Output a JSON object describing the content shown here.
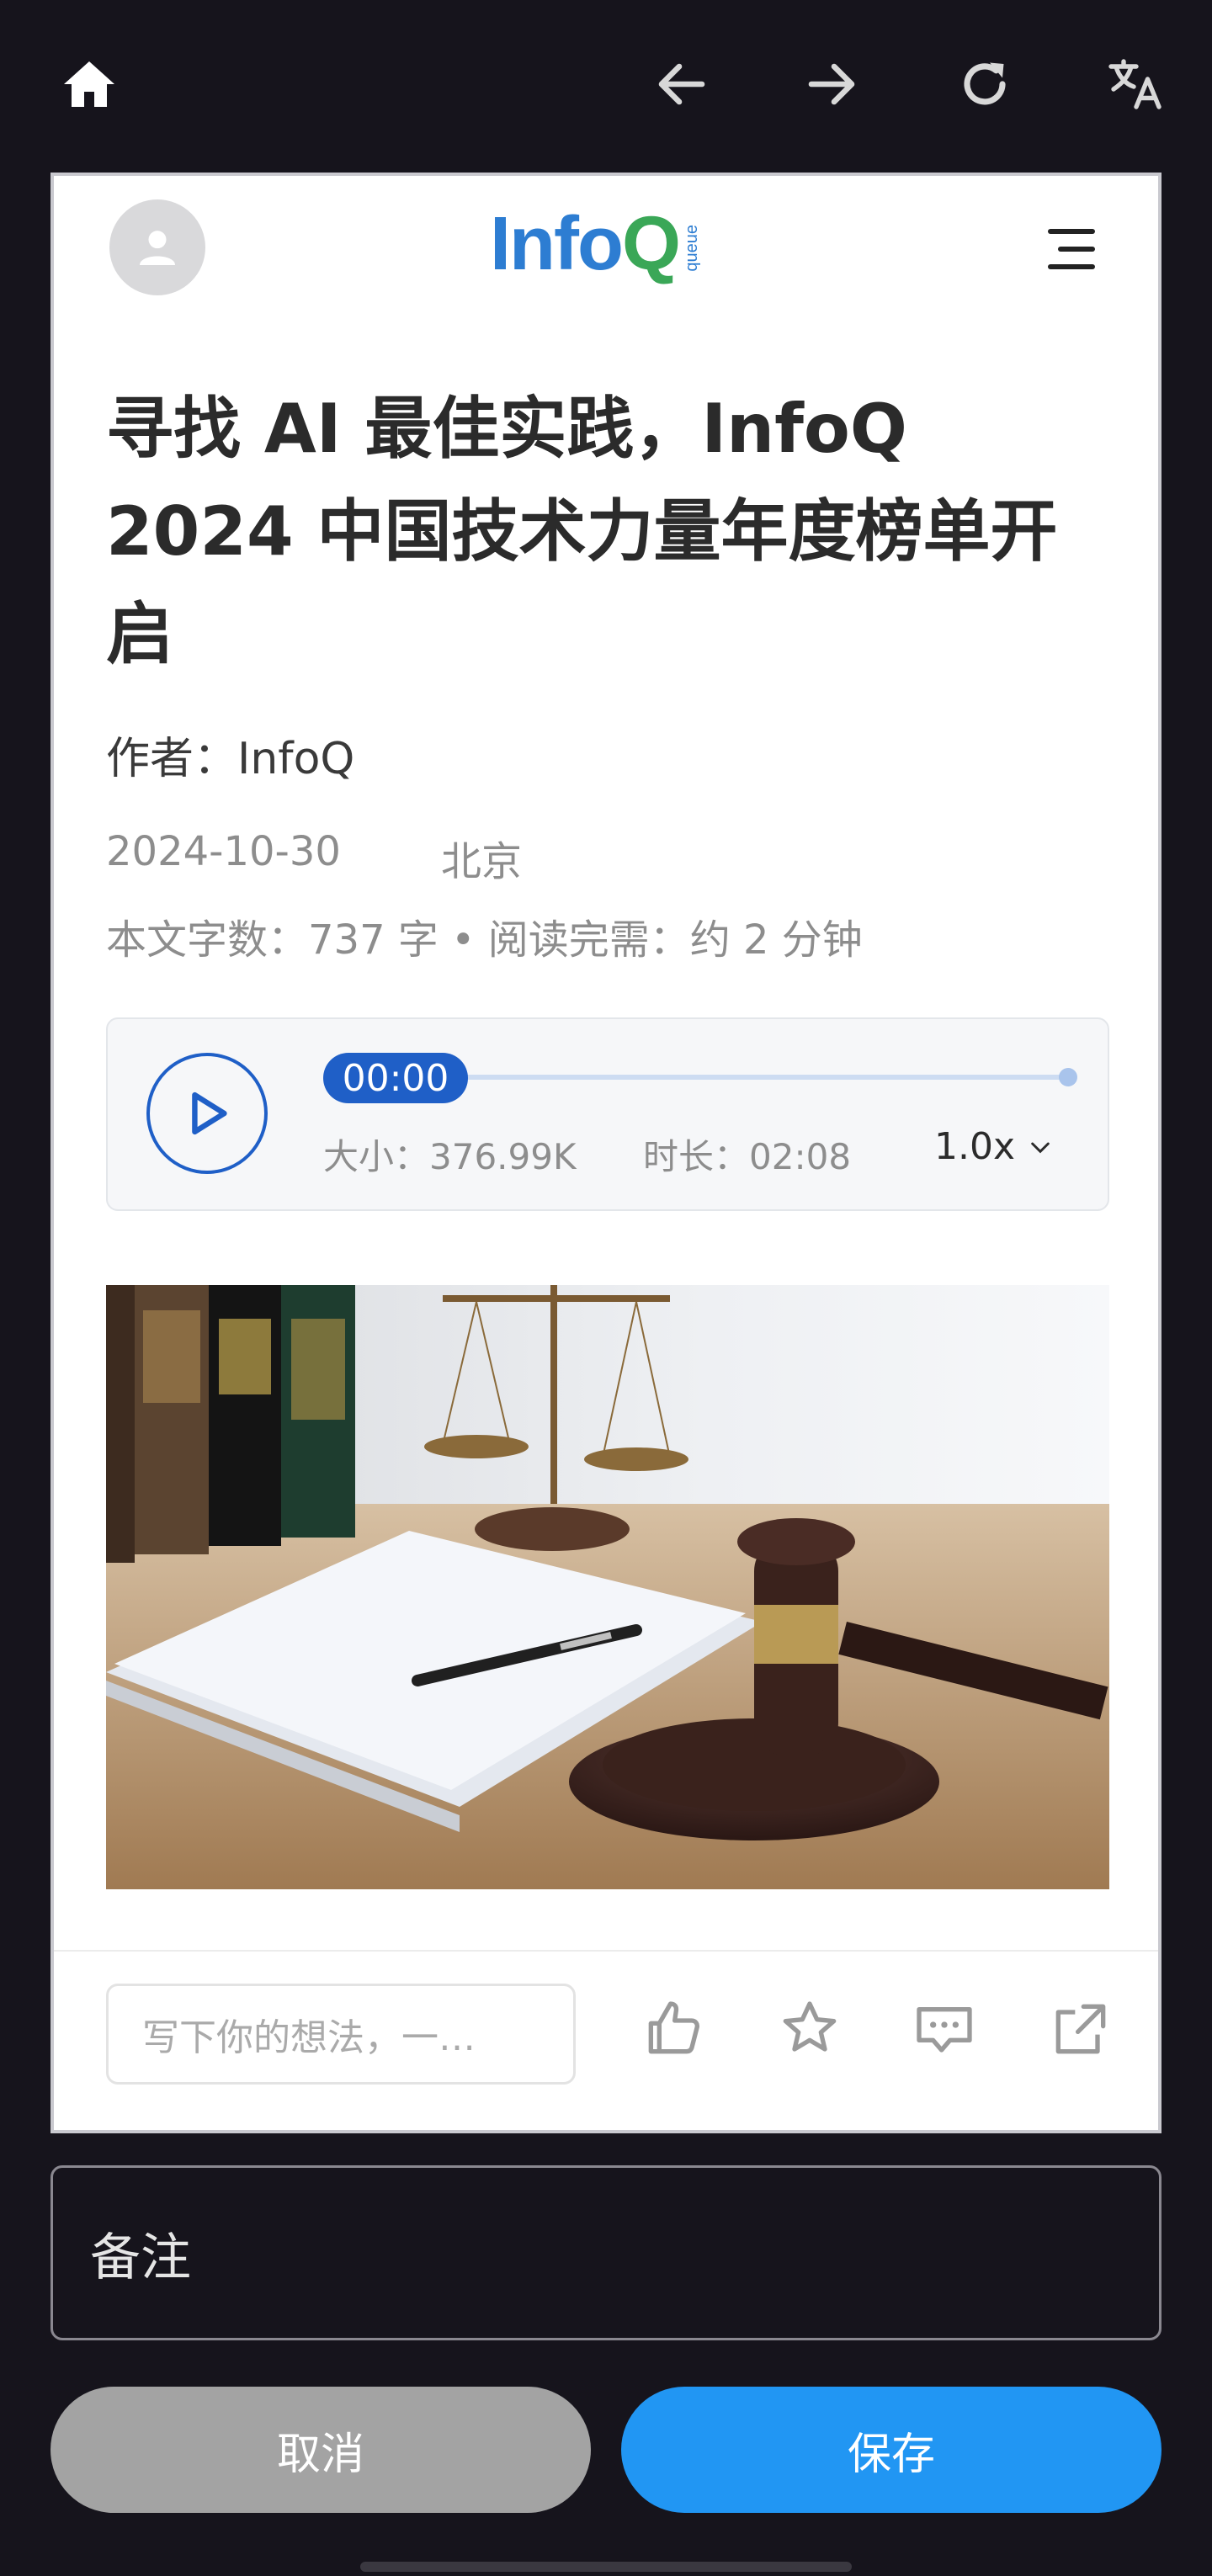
{
  "toolbar": {
    "icons": [
      "home-icon",
      "arrow-left-icon",
      "arrow-right-icon",
      "refresh-icon",
      "translate-icon"
    ]
  },
  "site": {
    "logo_info": "Info",
    "logo_q": "Q",
    "logo_queue": "queue",
    "avatar_icon": "user-icon",
    "menu_icon": "hamburger-menu-icon"
  },
  "article": {
    "title": "寻找 AI 最佳实践，InfoQ 2024 中国技术力量年度榜单开启",
    "author": "作者：InfoQ",
    "date": "2024-10-30",
    "city": "北京",
    "stats": "本文字数：737 字 • 阅读完需：约 2 分钟"
  },
  "player": {
    "current_time": "00:00",
    "size": "大小：376.99K",
    "duration": "时长：02:08",
    "speed": "1.0x",
    "progress": 0
  },
  "hero": {
    "alt": "hero-image-gavel-scales"
  },
  "actions": {
    "comment_placeholder": "写下你的想法，一…",
    "icons": [
      "thumbs-up-icon",
      "star-icon",
      "comment-icon",
      "share-icon"
    ]
  },
  "form": {
    "note_placeholder": "备注",
    "cancel_label": "取消",
    "save_label": "保存"
  },
  "colors": {
    "accent_blue": "#2196f3",
    "player_blue": "#1f5fc7",
    "background": "#16141c"
  }
}
